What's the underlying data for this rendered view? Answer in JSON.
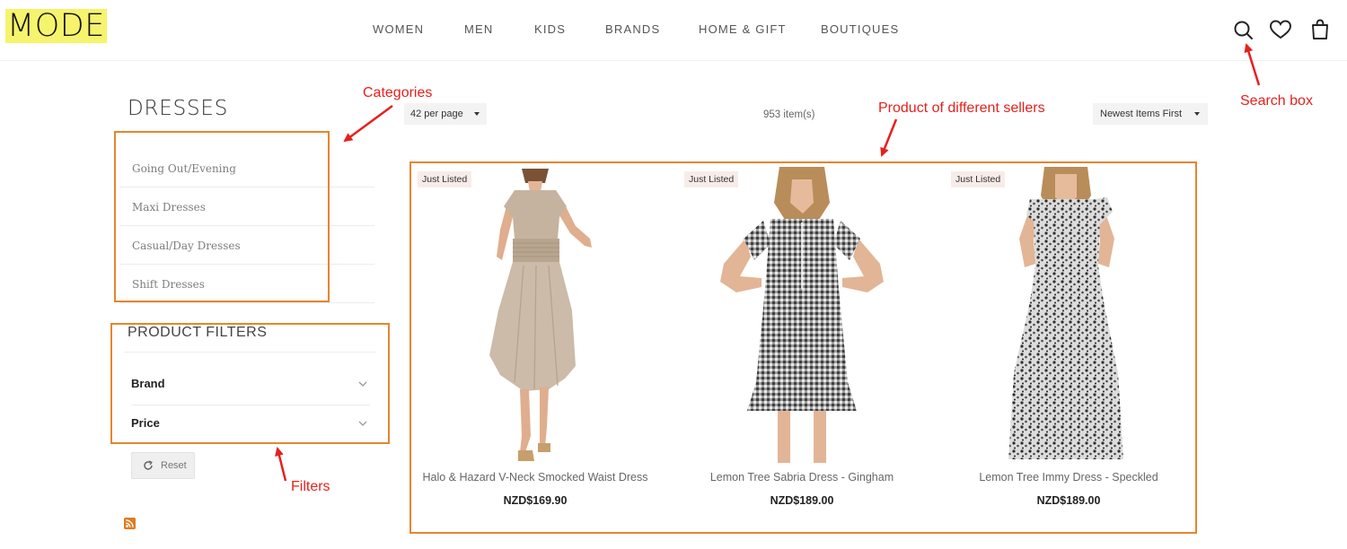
{
  "header": {
    "logo": "MODE",
    "nav": [
      "WOMEN",
      "MEN",
      "KIDS",
      "BRANDS",
      "HOME & GIFT",
      "BOUTIQUES"
    ],
    "icons": [
      "search-icon",
      "heart-icon",
      "bag-icon"
    ]
  },
  "sidebar": {
    "category_title": "DRESSES",
    "categories": [
      "Going Out/Evening",
      "Maxi Dresses",
      "Casual/Day Dresses",
      "Shift Dresses"
    ],
    "filters_title": "PRODUCT FILTERS",
    "filters": [
      "Brand",
      "Price"
    ],
    "reset_label": "Reset"
  },
  "toolbar": {
    "per_page": "42 per page",
    "item_count": "953 item(s)",
    "sort": "Newest Items First"
  },
  "products": [
    {
      "badge": "Just Listed",
      "name": "Halo & Hazard V-Neck Smocked Waist Dress",
      "price": "NZD$169.90"
    },
    {
      "badge": "Just Listed",
      "name": "Lemon Tree Sabria Dress - Gingham",
      "price": "NZD$189.00"
    },
    {
      "badge": "Just Listed",
      "name": "Lemon Tree Immy Dress - Speckled",
      "price": "NZD$189.00"
    }
  ],
  "annotations": {
    "categories": "Categories",
    "products": "Product of different sellers",
    "search": "Search box",
    "filters": "Filters"
  },
  "colors": {
    "logo_highlight": "#f6f36c",
    "annotation_box": "#e4862f",
    "annotation_text": "#e5211d",
    "badge_bg": "#f8ece9"
  }
}
